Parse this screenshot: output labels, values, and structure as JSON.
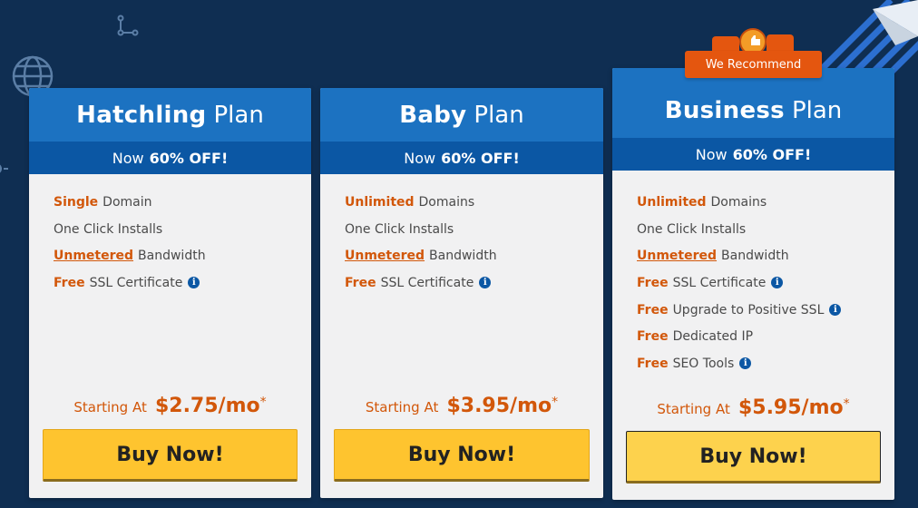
{
  "plans": [
    {
      "name": "Hatchling",
      "suffix": "Plan",
      "discount_prefix": "Now",
      "discount_value": "60% OFF!",
      "features": [
        {
          "highlight": "Single",
          "text": "Domain"
        },
        {
          "highlight": "",
          "text": "One Click Installs"
        },
        {
          "highlight": "Unmetered",
          "text": "Bandwidth"
        },
        {
          "highlight": "Free",
          "text": "SSL Certificate"
        }
      ],
      "price_label": "Starting At",
      "price": "$2.75/mo",
      "price_mark": "*",
      "button": "Buy Now!"
    },
    {
      "name": "Baby",
      "suffix": "Plan",
      "discount_prefix": "Now",
      "discount_value": "60% OFF!",
      "features": [
        {
          "highlight": "Unlimited",
          "text": "Domains"
        },
        {
          "highlight": "",
          "text": "One Click Installs"
        },
        {
          "highlight": "Unmetered",
          "text": "Bandwidth"
        },
        {
          "highlight": "Free",
          "text": "SSL Certificate"
        }
      ],
      "price_label": "Starting At",
      "price": "$3.95/mo",
      "price_mark": "*",
      "button": "Buy Now!"
    },
    {
      "name": "Business",
      "suffix": "Plan",
      "discount_prefix": "Now",
      "discount_value": "60% OFF!",
      "features": [
        {
          "highlight": "Unlimited",
          "text": "Domains"
        },
        {
          "highlight": "",
          "text": "One Click Installs"
        },
        {
          "highlight": "Unmetered",
          "text": "Bandwidth"
        },
        {
          "highlight": "Free",
          "text": "SSL Certificate"
        },
        {
          "highlight": "Free",
          "text": "Upgrade to Positive SSL"
        },
        {
          "highlight": "Free",
          "text": "Dedicated IP"
        },
        {
          "highlight": "Free",
          "text": "SEO Tools"
        }
      ],
      "price_label": "Starting At",
      "price": "$5.95/mo",
      "price_mark": "*",
      "button": "Buy Now!"
    }
  ],
  "badge": {
    "label": "We Recommend"
  },
  "icons": {
    "info": "info-circle-icon",
    "info_glyph": "i"
  },
  "colors": {
    "background": "#0f2e52",
    "header": "#1c72c1",
    "discount_bar": "#0b57a4",
    "accent": "#d2570a",
    "button": "#fec42f"
  }
}
